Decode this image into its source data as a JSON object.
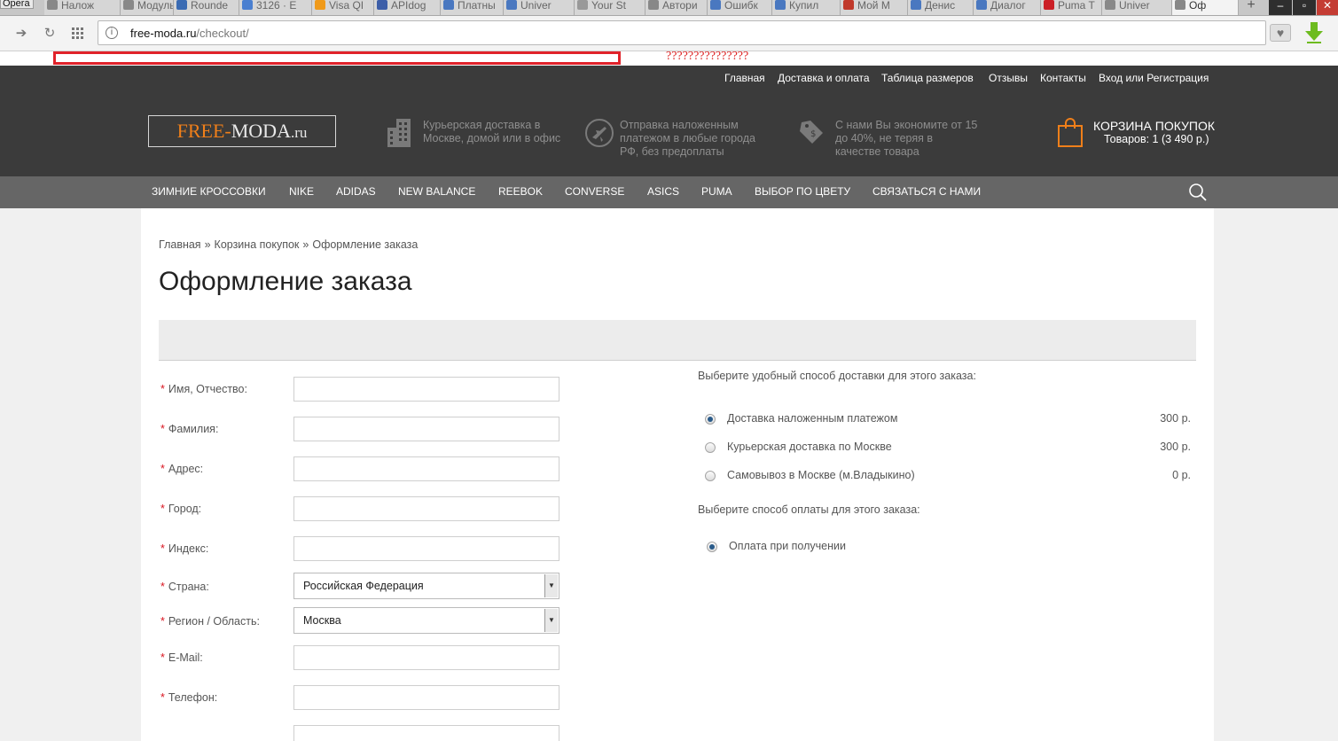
{
  "browser": {
    "menu_label": "Opera",
    "tabs": [
      {
        "label": "Налож",
        "icon": "page-icon",
        "color": "#888888"
      },
      {
        "label": "Модуль",
        "icon": "page-icon",
        "color": "#888888"
      },
      {
        "label": "Rounde",
        "icon": "cube-icon",
        "color": "#3a6bb3"
      },
      {
        "label": "3126 · E",
        "icon": "mail-icon",
        "color": "#4a7fd0"
      },
      {
        "label": "Visa QI",
        "icon": "q-icon",
        "color": "#f09a1a"
      },
      {
        "label": "APIdog",
        "icon": "b-icon",
        "color": "#3d5ea8"
      },
      {
        "label": "Платны",
        "icon": "check-icon",
        "color": "#4a78c0"
      },
      {
        "label": "Univer",
        "icon": "check-icon",
        "color": "#4a78c0"
      },
      {
        "label": "Your St",
        "icon": "store-icon",
        "color": "#999999"
      },
      {
        "label": "Автори",
        "icon": "page-icon",
        "color": "#888888"
      },
      {
        "label": "Ошибк",
        "icon": "check-icon",
        "color": "#4a78c0"
      },
      {
        "label": "Купил",
        "icon": "check-icon",
        "color": "#4a78c0"
      },
      {
        "label": "Мой М",
        "icon": "mail-icon",
        "color": "#c0392b"
      },
      {
        "label": "Денис",
        "icon": "check-icon",
        "color": "#4a78c0"
      },
      {
        "label": "Диалог",
        "icon": "chat-icon",
        "color": "#4a78c0"
      },
      {
        "label": "Puma T",
        "icon": "pinterest-icon",
        "color": "#cb2027"
      },
      {
        "label": "Univer",
        "icon": "page-icon",
        "color": "#888888"
      },
      {
        "label": "Оф",
        "icon": "page-icon",
        "color": "#888888"
      }
    ],
    "new_tab": "+",
    "url_host": "free-moda.ru",
    "url_path": "/checkout/",
    "annotation": "???????????????"
  },
  "site": {
    "top_links": [
      "Главная",
      "Доставка и оплата",
      "Таблица размеров",
      "Отзывы",
      "Контакты",
      "Вход или Регистрация"
    ],
    "logo": {
      "part1": "FREE-",
      "part2": "MODA",
      "part3": ".ru"
    },
    "features": [
      {
        "icon": "building-icon",
        "text": [
          "Курьерская доставка в",
          "Москве, домой или в офис"
        ]
      },
      {
        "icon": "plane-icon",
        "text": [
          "Отправка наложенным",
          "платежом в любые города",
          "РФ, без предоплаты"
        ]
      },
      {
        "icon": "price-tag-icon",
        "text": [
          "С нами Вы экономите от 15",
          "до 40%, не теряя в",
          "качестве товара"
        ]
      }
    ],
    "cart": {
      "title": "КОРЗИНА ПОКУПОК",
      "summary": "Товаров: 1 (3 490 р.)"
    },
    "menu": [
      "ЗИМНИЕ КРОССОВКИ",
      "NIKE",
      "ADIDAS",
      "NEW BALANCE",
      "REEBOK",
      "CONVERSE",
      "ASICS",
      "PUMA",
      "ВЫБОР ПО ЦВЕТУ",
      "СВЯЗАТЬСЯ С НАМИ"
    ]
  },
  "checkout": {
    "breadcrumbs": [
      "Главная",
      "Корзина покупок",
      "Оформление заказа"
    ],
    "breadcrumb_sep": "»",
    "title": "Оформление заказа",
    "required_mark": "*",
    "fields": [
      {
        "label": "Имя, Отчество:",
        "value": ""
      },
      {
        "label": "Фамилия:",
        "value": ""
      },
      {
        "label": "Адрес:",
        "value": ""
      },
      {
        "label": "Город:",
        "value": ""
      },
      {
        "label": "Индекс:",
        "value": ""
      },
      {
        "label": "Страна:",
        "value": "Российская Федерация"
      },
      {
        "label": "Регион / Область:",
        "value": "Москва"
      },
      {
        "label": "E-Mail:",
        "value": ""
      },
      {
        "label": "Телефон:",
        "value": ""
      }
    ],
    "delivery_title": "Выберите удобный способ доставки для этого заказа:",
    "delivery_options": [
      {
        "label": "Доставка наложенным платежом",
        "price": "300 р.",
        "selected": true
      },
      {
        "label": "Курьерская доставка по Москве",
        "price": "300 р.",
        "selected": false
      },
      {
        "label": "Самовывоз в Москве (м.Владыкино)",
        "price": "0 р.",
        "selected": false
      }
    ],
    "payment_title": "Выберите способ оплаты для этого заказа:",
    "payment_options": [
      {
        "label": "Оплата при получении",
        "selected": true
      }
    ]
  },
  "colors": {
    "header_bg": "#3b3b3b",
    "menu_bg": "#666666",
    "accent": "#ef7f1a",
    "required": "#d9131e"
  }
}
